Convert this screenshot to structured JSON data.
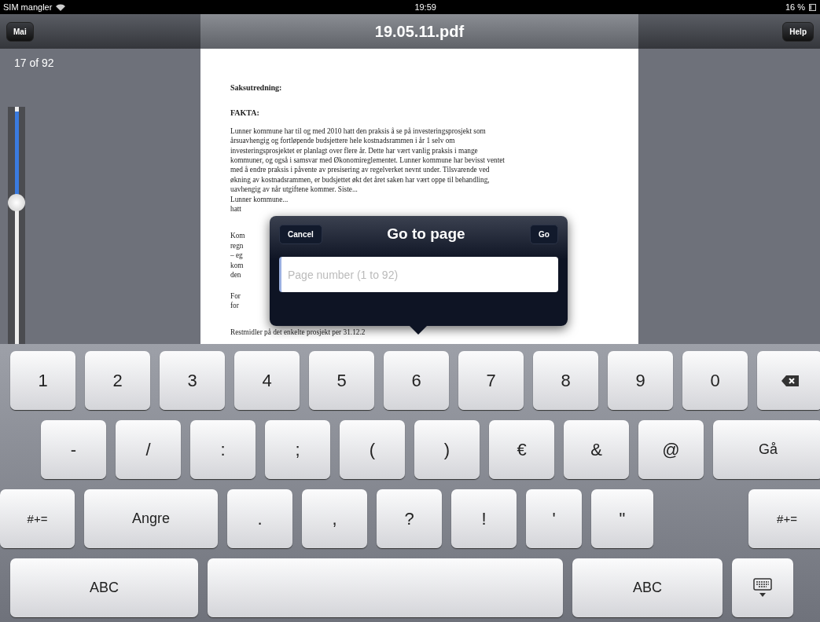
{
  "status_bar": {
    "carrier": "SIM mangler",
    "time": "19:59",
    "battery": "16 %"
  },
  "nav_bar": {
    "back_button": "Mai",
    "title": "19.05.11.pdf",
    "help_button": "Help"
  },
  "page_indicator": "17 of 92",
  "page_slider": {
    "level": 0.38
  },
  "document": {
    "heading": "Saksutredning:",
    "subheading": "FAKTA:",
    "paragraphs": [
      [
        "Lunner kommune har til og med 2010 hatt den praksis å se på investeringsprosjekt som",
        "årsuavhengig og fortløpende budsjettere hele kostnadsrammen i år 1 selv om",
        "investeringsprosjektet er planlagt over flere år. Dette har vært vanlig praksis i mange",
        "kommuner, og også i samsvar med Økonomireglementet. Lunner kommune har bevisst ventet",
        "med å endre praksis i påvente av presisering av regelverket nevnt under. Tilsvarende ved",
        "økning av kostnadsrammen, er budsjettet økt det året saken har vært oppe til behandling,",
        "uavhengig av når utgiftene kommer. Siste...",
        "Lunner kommune...",
        "hatt"
      ],
      [
        "Kom",
        "regn",
        "– eg",
        "kom",
        "den"
      ],
      [
        "For",
        "for"
      ],
      [
        "Restmidler på det enkelte prosjekt per 31.12.2"
      ]
    ]
  },
  "dialog": {
    "title": "Go to page",
    "cancel_button": "Cancel",
    "go_button": "Go",
    "input": {
      "placeholder": "Page number (1 to 92)"
    }
  },
  "keyboard": {
    "rows": [
      [
        {
          "kind": "key",
          "label": "1"
        },
        {
          "kind": "key",
          "label": "2"
        },
        {
          "kind": "key",
          "label": "3"
        },
        {
          "kind": "key",
          "label": "4"
        },
        {
          "kind": "key",
          "label": "5"
        },
        {
          "kind": "key",
          "label": "6"
        },
        {
          "kind": "key",
          "label": "7"
        },
        {
          "kind": "key",
          "label": "8"
        },
        {
          "kind": "key",
          "label": "9"
        },
        {
          "kind": "key",
          "label": "0"
        },
        {
          "kind": "backspace"
        }
      ],
      [
        {
          "kind": "key",
          "label": "-"
        },
        {
          "kind": "key",
          "label": "/"
        },
        {
          "kind": "key",
          "label": ":"
        },
        {
          "kind": "key",
          "label": ";"
        },
        {
          "kind": "key",
          "label": "("
        },
        {
          "kind": "key",
          "label": ")"
        },
        {
          "kind": "key",
          "label": "€"
        },
        {
          "kind": "key",
          "label": "&"
        },
        {
          "kind": "key",
          "label": "@"
        },
        {
          "kind": "return",
          "label": "Gå"
        }
      ],
      [
        {
          "kind": "shift",
          "label": "#+="
        },
        {
          "kind": "wide",
          "label": "Angre"
        },
        {
          "kind": "key",
          "label": "."
        },
        {
          "kind": "key",
          "label": ","
        },
        {
          "kind": "key",
          "label": "?"
        },
        {
          "kind": "key",
          "label": "!"
        },
        {
          "kind": "key",
          "label": "'"
        },
        {
          "kind": "key",
          "label": "\""
        },
        {
          "kind": "gap"
        },
        {
          "kind": "shift",
          "label": "#+="
        }
      ],
      [
        {
          "kind": "abc",
          "label": "ABC"
        },
        {
          "kind": "space"
        },
        {
          "kind": "abc2",
          "label": "ABC"
        },
        {
          "kind": "dismiss"
        }
      ]
    ]
  }
}
